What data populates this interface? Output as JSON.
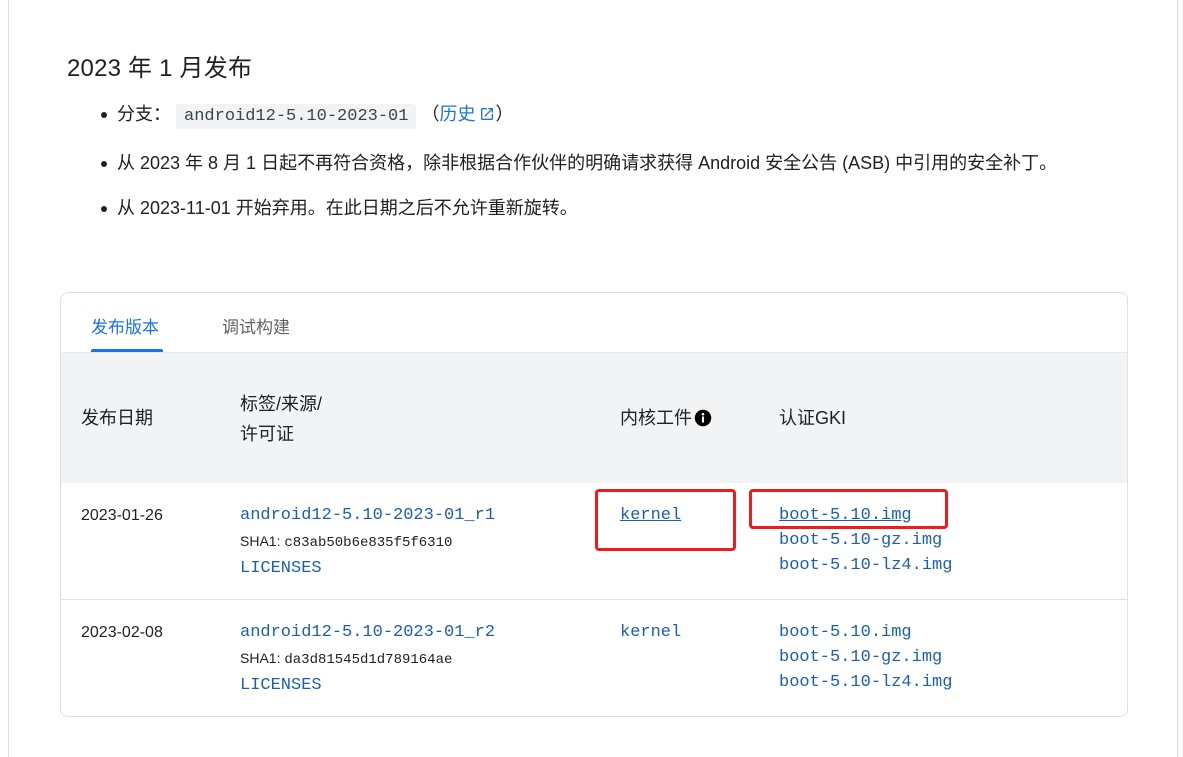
{
  "section": {
    "title": "2023 年 1 月发布"
  },
  "bullets": {
    "branch_label": "分支：",
    "branch_code": "android12-5.10-2023-01",
    "history_open": "（",
    "history_link": "历史",
    "history_close": "）",
    "eligibility": "从 2023 年 8 月 1 日起不再符合资格，除非根据合作伙伴的明确请求获得 Android 安全公告 (ASB) 中引用的安全补丁。",
    "deprecation": "从 2023-11-01 开始弃用。在此日期之后不允许重新旋转。"
  },
  "tabs": [
    {
      "label": "发布版本",
      "active": true
    },
    {
      "label": "调试构建",
      "active": false
    }
  ],
  "table": {
    "headers": {
      "date": "发布日期",
      "tag_line1": "标签/来源/",
      "tag_line2": "许可证",
      "kernel": "内核工件",
      "gki": "认证GKI"
    },
    "rows": [
      {
        "date": "2023-01-26",
        "tag": "android12-5.10-2023-01_r1",
        "sha_label": "SHA1: ",
        "sha": "c83ab50b6e835f5f6310",
        "licenses": "LICENSES",
        "kernel": "kernel",
        "images": [
          "boot-5.10.img",
          "boot-5.10-gz.img",
          "boot-5.10-lz4.img"
        ]
      },
      {
        "date": "2023-02-08",
        "tag": "android12-5.10-2023-01_r2",
        "sha_label": "SHA1: ",
        "sha": "da3d81545d1d789164ae",
        "licenses": "LICENSES",
        "kernel": "kernel",
        "images": [
          "boot-5.10.img",
          "boot-5.10-gz.img",
          "boot-5.10-lz4.img"
        ]
      }
    ]
  },
  "colors": {
    "link": "#1a73e8",
    "code_link": "#1a5fb4",
    "annotation": "#ee1c1c",
    "header_bg": "#f1f3f4"
  }
}
